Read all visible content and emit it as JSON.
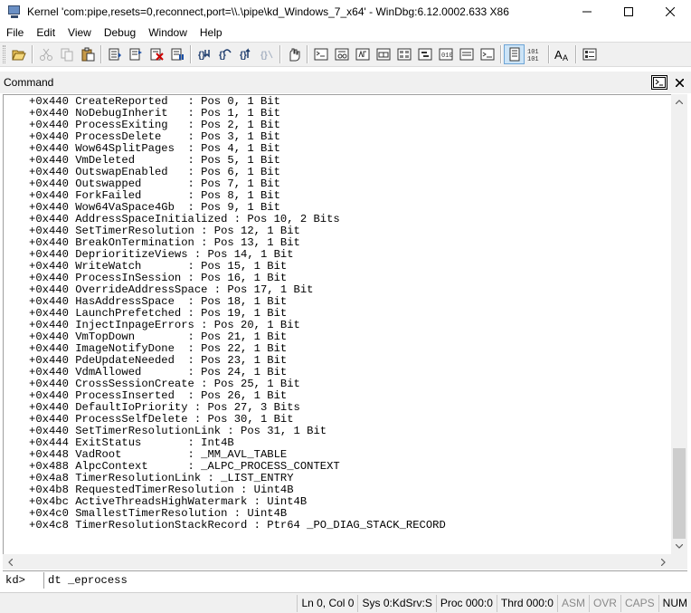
{
  "window": {
    "title": "Kernel 'com:pipe,resets=0,reconnect,port=\\\\.\\pipe\\kd_Windows_7_x64' - WinDbg:6.12.0002.633 X86"
  },
  "menu": [
    "File",
    "Edit",
    "View",
    "Debug",
    "Window",
    "Help"
  ],
  "toolbar": {
    "icons": [
      "open-icon",
      "cut-icon",
      "copy-icon",
      "paste-icon",
      "go-icon",
      "restart-icon",
      "stop-debugging-icon",
      "break-icon",
      "step-into-icon",
      "step-over-icon",
      "step-out-icon",
      "run-to-cursor-icon",
      "insert-breakpoint-icon",
      "command-window-icon",
      "watch-window-icon",
      "locals-window-icon",
      "registers-window-icon",
      "memory-window-icon",
      "call-stack-icon",
      "disassembly-icon",
      "scratch-pad-icon",
      "source-mode-icon",
      "hex-mode-icon",
      "font-icon",
      "options-icon"
    ]
  },
  "command_window": {
    "title": "Command",
    "output": [
      "+0x440 CreateReported   : Pos 0, 1 Bit",
      "+0x440 NoDebugInherit   : Pos 1, 1 Bit",
      "+0x440 ProcessExiting   : Pos 2, 1 Bit",
      "+0x440 ProcessDelete    : Pos 3, 1 Bit",
      "+0x440 Wow64SplitPages  : Pos 4, 1 Bit",
      "+0x440 VmDeleted        : Pos 5, 1 Bit",
      "+0x440 OutswapEnabled   : Pos 6, 1 Bit",
      "+0x440 Outswapped       : Pos 7, 1 Bit",
      "+0x440 ForkFailed       : Pos 8, 1 Bit",
      "+0x440 Wow64VaSpace4Gb  : Pos 9, 1 Bit",
      "+0x440 AddressSpaceInitialized : Pos 10, 2 Bits",
      "+0x440 SetTimerResolution : Pos 12, 1 Bit",
      "+0x440 BreakOnTermination : Pos 13, 1 Bit",
      "+0x440 DeprioritizeViews : Pos 14, 1 Bit",
      "+0x440 WriteWatch       : Pos 15, 1 Bit",
      "+0x440 ProcessInSession : Pos 16, 1 Bit",
      "+0x440 OverrideAddressSpace : Pos 17, 1 Bit",
      "+0x440 HasAddressSpace  : Pos 18, 1 Bit",
      "+0x440 LaunchPrefetched : Pos 19, 1 Bit",
      "+0x440 InjectInpageErrors : Pos 20, 1 Bit",
      "+0x440 VmTopDown        : Pos 21, 1 Bit",
      "+0x440 ImageNotifyDone  : Pos 22, 1 Bit",
      "+0x440 PdeUpdateNeeded  : Pos 23, 1 Bit",
      "+0x440 VdmAllowed       : Pos 24, 1 Bit",
      "+0x440 CrossSessionCreate : Pos 25, 1 Bit",
      "+0x440 ProcessInserted  : Pos 26, 1 Bit",
      "+0x440 DefaultIoPriority : Pos 27, 3 Bits",
      "+0x440 ProcessSelfDelete : Pos 30, 1 Bit",
      "+0x440 SetTimerResolutionLink : Pos 31, 1 Bit",
      "+0x444 ExitStatus       : Int4B",
      "+0x448 VadRoot          : _MM_AVL_TABLE",
      "+0x488 AlpcContext      : _ALPC_PROCESS_CONTEXT",
      "+0x4a8 TimerResolutionLink : _LIST_ENTRY",
      "+0x4b8 RequestedTimerResolution : Uint4B",
      "+0x4bc ActiveThreadsHighWatermark : Uint4B",
      "+0x4c0 SmallestTimerResolution : Uint4B",
      "+0x4c8 TimerResolutionStackRecord : Ptr64 _PO_DIAG_STACK_RECORD"
    ],
    "prompt": "kd>",
    "input_value": "dt _eprocess"
  },
  "status_bar": {
    "cursor": "Ln 0, Col 0",
    "sys": "Sys 0:KdSrv:S",
    "proc": "Proc 000:0",
    "thrd": "Thrd 000:0",
    "asm": "ASM",
    "ovr": "OVR",
    "caps": "CAPS",
    "num": "NUM"
  }
}
